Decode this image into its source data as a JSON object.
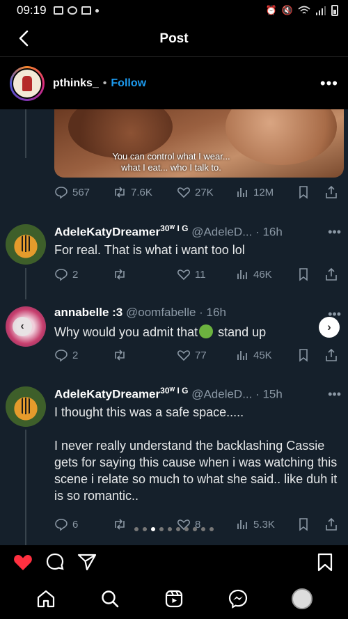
{
  "status_bar": {
    "time": "09:19"
  },
  "nav": {
    "title": "Post"
  },
  "post": {
    "username": "pthinks_",
    "separator": "•",
    "follow_label": "Follow"
  },
  "media": {
    "subtitle_line1": "You can control what I wear...",
    "subtitle_line2": "what I eat... who I talk to."
  },
  "main_tweet_actions": {
    "replies": "567",
    "retweets": "7.6K",
    "likes": "27K",
    "views": "12M"
  },
  "replies": [
    {
      "name": "AdeleKatyDreamer",
      "badge": "30ᵂ I G",
      "handle": "@AdeleD... · 16h",
      "text": "For real. That is what i want too lol",
      "replies": "2",
      "retweets": "",
      "likes": "11",
      "views": "46K"
    },
    {
      "name": "annabelle :3",
      "badge": "",
      "handle": "@oomfabelle · 16h",
      "text_before": "Why would you admit that",
      "text_after": " stand up",
      "replies": "2",
      "retweets": "",
      "likes": "77",
      "views": "45K"
    },
    {
      "name": "AdeleKatyDreamer",
      "badge": "30ᵂ I G",
      "handle": "@AdeleD... · 15h",
      "text_p1": "I thought this was a safe space.....",
      "text_p2": "I never really understand the backlashing Cassie gets for saying this cause when i was watching this scene i relate so much to what she said.. like duh it is so romantic..",
      "replies": "6",
      "retweets": "",
      "likes": "8",
      "views": "5.3K"
    }
  ],
  "carousel": {
    "total": 10,
    "active": 2
  },
  "colors": {
    "accent": "#1d9bf0",
    "like": "#ff3040",
    "tweet_bg": "#15202b",
    "muted": "#8b98a5"
  },
  "icons": [
    "back-arrow-icon",
    "more-icon",
    "reply-icon",
    "retweet-icon",
    "heart-icon",
    "views-icon",
    "bookmark-icon",
    "share-icon",
    "home-icon",
    "search-icon",
    "reels-icon",
    "messenger-icon",
    "profile-icon"
  ]
}
